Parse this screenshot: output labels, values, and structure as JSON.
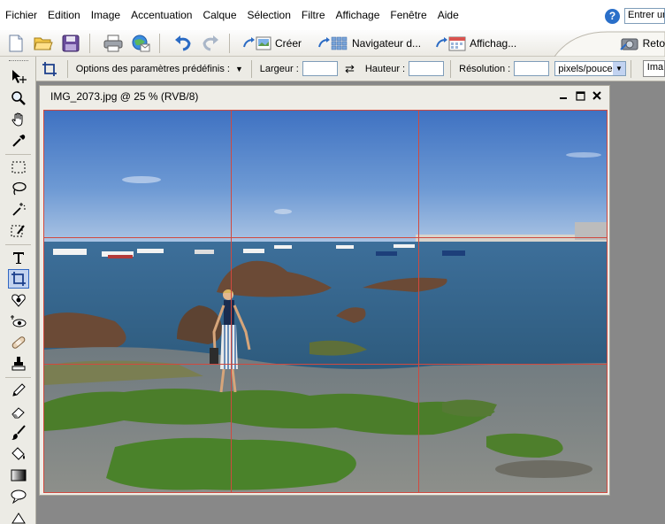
{
  "menubar": {
    "items": [
      "Fichier",
      "Edition",
      "Image",
      "Accentuation",
      "Calque",
      "Sélection",
      "Filtre",
      "Affichage",
      "Fenêtre",
      "Aide"
    ],
    "help_placeholder": "Entrer ur"
  },
  "toolbar": {
    "create_label": "Créer",
    "navigator_label": "Navigateur d...",
    "view_label": "Affichag...",
    "retouch_label": "Reto"
  },
  "options": {
    "presets_label": "Options des paramètres prédéfinis :",
    "width_label": "Largeur :",
    "height_label": "Hauteur :",
    "resolution_label": "Résolution :",
    "unit_value": "pixels/pouce",
    "image_button": "Ima"
  },
  "document": {
    "title": "IMG_2073.jpg @ 25 % (RVB/8)"
  },
  "colors": {
    "grid_line": "#d0493f",
    "accent": "#3167c3"
  }
}
